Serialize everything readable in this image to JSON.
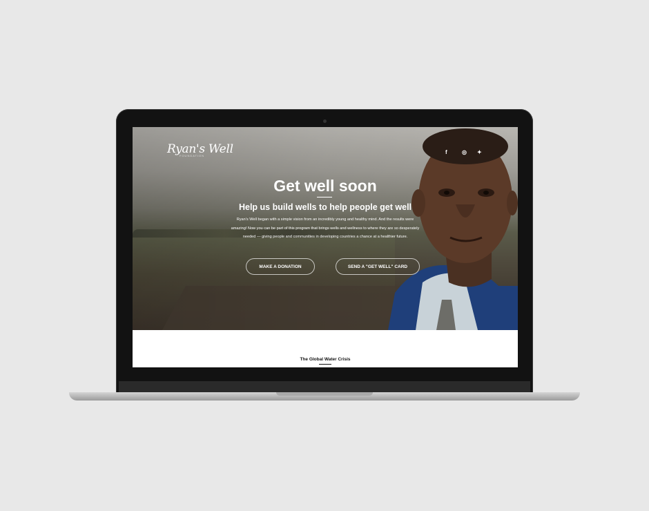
{
  "logo": {
    "name": "Ryan's Well",
    "tagline": "FOUNDATION"
  },
  "social": [
    {
      "icon": "facebook-icon",
      "glyph": "f"
    },
    {
      "icon": "instagram-icon",
      "glyph": "◎"
    },
    {
      "icon": "twitter-icon",
      "glyph": "✦"
    }
  ],
  "hero": {
    "title": "Get well soon",
    "subtitle": "Help us build wells to help people get well",
    "body": "Ryan's Well began with a simple vision from an incredibly young and healthy mind. And the results were amazing! Now you can be part of this program that brings wells and wellness to where they are so desperately needed — giving people and communities in developing countries a chance at a healthier future.",
    "primary_button": "MAKE A DONATION",
    "secondary_button": "SEND A \"GET WELL\" CARD"
  },
  "section": {
    "title": "The Global Water Crisis"
  }
}
